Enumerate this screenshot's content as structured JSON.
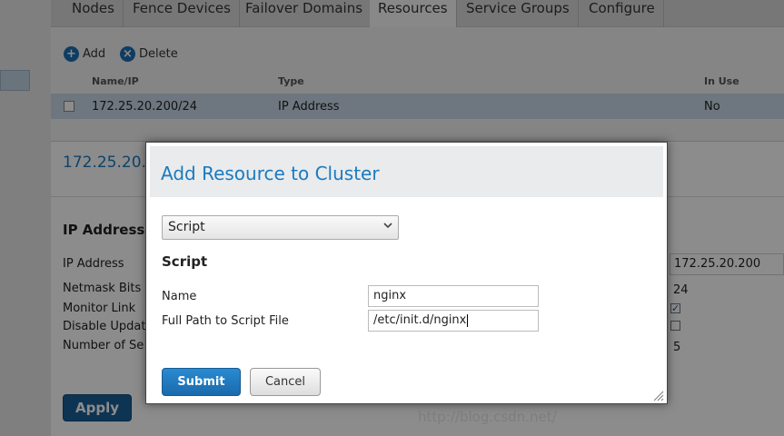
{
  "tabs": [
    "Nodes",
    "Fence Devices",
    "Failover Domains",
    "Resources",
    "Service Groups",
    "Configure"
  ],
  "active_tab": "Resources",
  "toolbar": {
    "add_label": "Add",
    "delete_label": "Delete",
    "add_icon": "plus-icon",
    "delete_icon": "close-icon"
  },
  "resources_table": {
    "headers": [
      "Name/IP",
      "Type",
      "In Use"
    ],
    "rows": [
      {
        "name": "172.25.20.200/24",
        "type": "IP Address",
        "in_use": "No"
      }
    ]
  },
  "detail": {
    "title": "172.25.20.",
    "section": "IP Address",
    "props": [
      {
        "label": "IP Address",
        "value": "172.25.20.200"
      },
      {
        "label": "Netmask Bits",
        "value": "24"
      },
      {
        "label": "Monitor Link",
        "checked": true
      },
      {
        "label": "Disable Updat",
        "checked": false
      },
      {
        "label": "Number of Se",
        "value": "5"
      }
    ],
    "apply_label": "Apply"
  },
  "footer_text": "http://blog.csdn.net/",
  "modal": {
    "title": "Add Resource to Cluster",
    "type_select": "Script",
    "section_title": "Script",
    "fields": [
      {
        "label": "Name",
        "value": "nginx"
      },
      {
        "label": "Full Path to Script File",
        "value": "/etc/init.d/nginx"
      }
    ],
    "submit_label": "Submit",
    "cancel_label": "Cancel"
  },
  "colors": {
    "accent": "#1a7bbf",
    "primary_button": "#1a6aac",
    "selected_row": "#c8d9e8"
  }
}
